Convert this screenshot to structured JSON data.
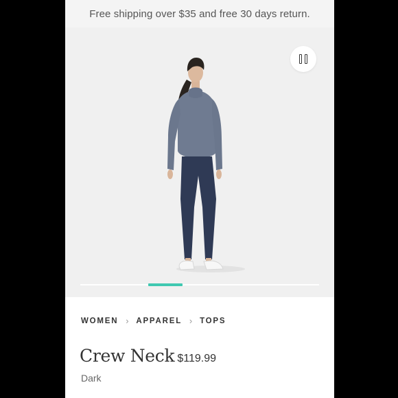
{
  "promo": {
    "text": "Free shipping over $35 and free 30 days return."
  },
  "carousel": {
    "control": "pause-icon",
    "active_slide": 2,
    "slide_count": 7,
    "indicator_color": "#3fc8b0"
  },
  "breadcrumb": {
    "items": [
      "WOMEN",
      "APPAREL",
      "TOPS"
    ],
    "separator_icon": "chevron-right-icon"
  },
  "product": {
    "name": "Crew Neck",
    "price": "$119.99",
    "color": "Dark"
  },
  "colors": {
    "background": "#000000",
    "accent": "#3fc8b0",
    "text": "#333333"
  }
}
